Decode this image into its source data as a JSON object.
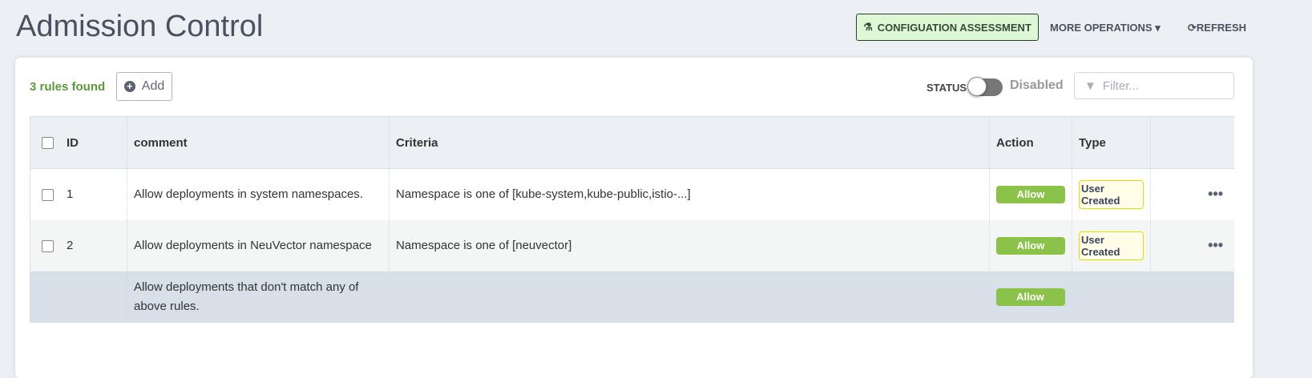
{
  "header": {
    "title": "Admission Control",
    "config_assessment": "CONFIGUATION ASSESSMENT",
    "more_operations": "MORE OPERATIONS",
    "refresh": "REFRESH"
  },
  "toolbar": {
    "found": "3 rules found",
    "add": "Add",
    "status_label": "STATUS",
    "status_value": "Disabled",
    "filter_placeholder": "Filter..."
  },
  "table": {
    "columns": [
      "ID",
      "comment",
      "Criteria",
      "Action",
      "Type"
    ],
    "rows": [
      {
        "id": "1",
        "comment": "Allow deployments in system namespaces.",
        "criteria": "Namespace is one of [kube-system,kube-public,istio-...]",
        "action": "Allow",
        "type": "User Created"
      },
      {
        "id": "2",
        "comment": "Allow deployments in NeuVector namespace",
        "criteria": "Namespace is one of [neuvector]",
        "action": "Allow",
        "type": "User Created"
      },
      {
        "id": "",
        "comment": "Allow deployments that don't match any of above rules.",
        "criteria": "",
        "action": "Allow",
        "type": ""
      }
    ]
  },
  "colors": {
    "allow": "#8bc34a",
    "found": "#5a9a3a",
    "cfg_bg": "#dcf8d4"
  }
}
